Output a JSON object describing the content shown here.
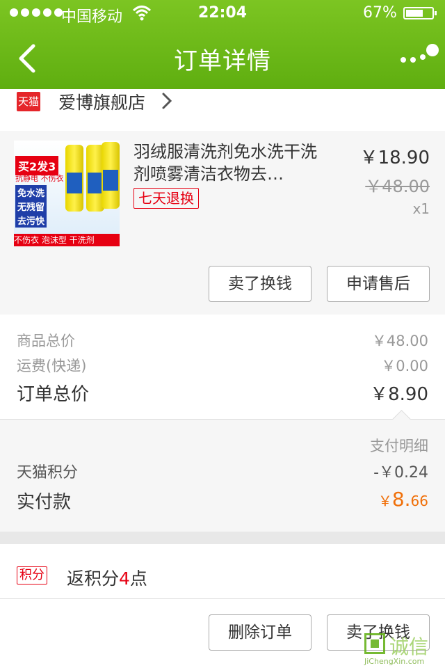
{
  "status_bar": {
    "carrier": "中国移动",
    "time": "22:04",
    "battery_percent": "67%",
    "battery_level": 0.67
  },
  "nav": {
    "title": "订单详情",
    "back_icon": "chevron-left-icon",
    "more_icon": "more-dots-icon"
  },
  "store": {
    "badge": "天猫",
    "name": "爱博旗舰店"
  },
  "item": {
    "title": "羽绒服清洗剂免水洗干洗剂喷雾清洁衣物去…",
    "badge": "七天退换",
    "price": "￥18.90",
    "original_price": "￥48.00",
    "quantity": "x1",
    "thumb_text": {
      "sale": "买2发3",
      "tag": "抗静电 不伤衣",
      "line1": "免水洗",
      "line2": "无残留",
      "line3": "去污快",
      "bottom": "不伤衣 泡沫型 干洗剂"
    },
    "buttons": {
      "sell": "卖了换钱",
      "after_sale": "申请售后"
    }
  },
  "totals": {
    "goods_label": "商品总价",
    "goods_value": "￥48.00",
    "shipping_label": "运费(快递)",
    "shipping_value": "￥0.00",
    "order_label": "订单总价",
    "order_value": "￥8.90"
  },
  "payment": {
    "detail_link": "支付明细",
    "points_label": "天猫积分",
    "points_value": "-￥0.24",
    "actual_label": "实付款",
    "actual_prefix": "￥",
    "actual_major": "8.",
    "actual_minor": "66"
  },
  "points": {
    "badge": "积分",
    "text_prefix": "返积分",
    "count": "4",
    "text_suffix": "点"
  },
  "actions": {
    "delete": "删除订单",
    "sell": "卖了换钱"
  },
  "watermark": {
    "text": "诚信",
    "url": "JiChengXin.com"
  },
  "colors": {
    "header_green": "#6bbb18",
    "tmall_red": "#e60012",
    "actual_orange": "#f0700a"
  }
}
